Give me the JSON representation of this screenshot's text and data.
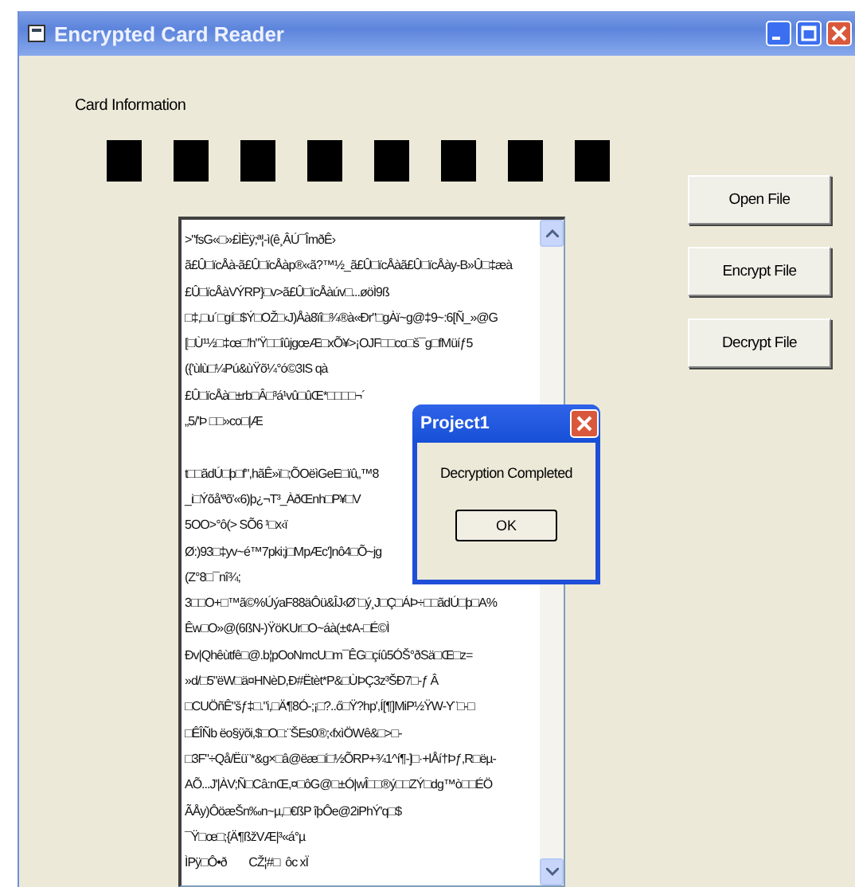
{
  "window": {
    "title": "Encrypted Card Reader"
  },
  "card_label": "Card Information",
  "buttons": [
    "Open File",
    "Encrypt File",
    "Decrypt File"
  ],
  "text_blocks": [
    [
      ">\"fsG«□»£ÌÈÿ;ª¦-ì(ê¸ÂÚ¯ÎmðÊ›",
      "ã£Û□ïcÅà-ã£Û□ïcÅàp®«ã?™½_ã£Û□ïcÅàã£Û□ïcÅày-B»Û□‡æà",
      "£Û□ïcÅàVÝRP}□v>ã£Û□ïcÅàúv□...øöÌ9ß",
      "□‡,□u´□gí□$Ý□OŽ□‹J)Åà8ïî□¾®à«Ðr\"□gÀï~g@‡9~:6[Ñ_»@G",
      "[□Ù¹½□‡œ□'h\"Ÿ□□îûjgœÆ□xÕ¥>¡OJF□□co□š¯g□fMüíƒ5",
      "({'ùlù□¼Pú&ùŸõ¼°ó©3IS qà",
      "£Û□ïcÅà□±rb□Â□³á¹vû□ûŒ*□□□□¬´",
      "„5/'Þ □□»co□|Æ"
    ],
    [
      "t□□ãdÚ□þ□f\",hãÊ»ï□;ÕOëìGeE□ïû„™8",
      "_i□Ýõå'ªõ'«6)þ¿¬T³_ÀðŒnh□P¥□V",
      "5OO>°ô(> SÕ6 ¹□x‹ï",
      "Ø:)93□‡yv~é™7pki;j□MpÆc']nô4□Õ~jg",
      "(Z°8□¯nî¾;",
      "3□□O+□™ã©%ÚýaF88äÔü&ÎJ‹Ø¨□ý¸J□Ç□ÁÞ÷□□ãdÚ□þ□A%",
      "Êw□O»@(6ßN-)ŸöKUr□O~áà(±¢A-□É©Ì",
      "Ðv|Qhêùtfê□@.b¦pOoNmcU□m¯ÊG□çíû5ÓŠ°ðSä□Œ□z=",
      "»d/□5\"ëW□ä¤HNèD,Ð#Ëtèt*P&□ÙÞÇ3z³ŠÐ7□-ƒ Â",
      "□CUÖñÊ\"šƒ‡□.\"i,□Ä¶8Ó-;¡□?..ő□Ÿ?hp',Í[¶]MiP½ŸW-Y¨□-□",
      "□ÊÎÑb ëo§ÿõi,$□O□:¨ŠEs0®;‹fxìÖWê&□>□-",
      "□3F\"÷Qå/Ëü¨*&g×□â@ëæ□í□½ÕRP+¾1^í¶-]□·+lÅí†Þƒ,R□ëµ-",
      "AÕ...J'|ÀV;Ñ□Câ:nŒ,¤□ôG@□±Ó|wÎ□□®ý□□ZÝ□dg™ò□□ÉÖ",
      "ÃÅy)ÔöæŠn‰n~µ,□€ßP îþÔe@2iPhÝ'q□$",
      "¯Ÿ□œ□;{Ä¶ßžVÆ|³«á°µ",
      "ÌPÿ□Ô•ð        CŽ¦#□  ôc xÏ"
    ]
  ],
  "dialog": {
    "title": "Project1",
    "message": "Decryption Completed",
    "button": "OK"
  }
}
